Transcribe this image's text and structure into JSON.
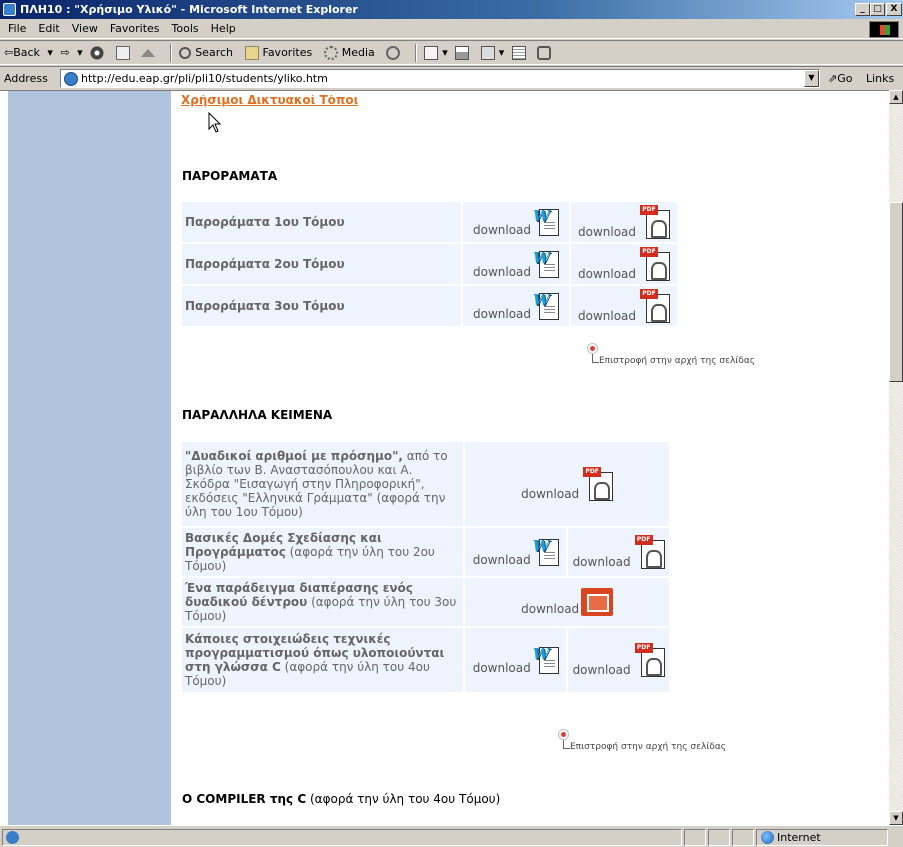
{
  "window": {
    "title": "ΠΛΗ10 : \"Χρήσιμο Υλικό\" - Microsoft Internet Explorer",
    "btn_min": "_",
    "btn_max": "□",
    "btn_close": "X"
  },
  "menubar": {
    "items": [
      "File",
      "Edit",
      "View",
      "Favorites",
      "Tools",
      "Help"
    ]
  },
  "toolbar": {
    "back": "⇦Back",
    "forward": "⇨",
    "search": "Search",
    "favorites": "Favorites",
    "media": "Media"
  },
  "address": {
    "label": "Address",
    "url": "http://edu.eap.gr/pli/pli10/students/yliko.htm",
    "go": "Go",
    "links": "Links »"
  },
  "status": {
    "zone": "Internet"
  },
  "page": {
    "top_link": "Χρήσιμοι Δικτυακοί Τόποι",
    "section1": {
      "title": "ΠΑΡΟΡΑΜΑΤΑ",
      "rows": [
        {
          "label": "Παροράματα 1ου Τόμου",
          "dl_word": "download",
          "dl_pdf": "download"
        },
        {
          "label": "Παροράματα 2ου Τόμου",
          "dl_word": "download",
          "dl_pdf": "download"
        },
        {
          "label": "Παροράματα 3ου Τόμου",
          "dl_word": "download",
          "dl_pdf": "download"
        }
      ],
      "back_to_top": "Επιστροφή στην αρχή της σελίδας"
    },
    "section2": {
      "title": "ΠΑΡΑΛΛΗΛΑ ΚΕΙΜΕΝΑ",
      "rows": [
        {
          "bold": "\"Δυαδικοί αριθμοί με πρόσημο\",",
          "desc": " από το βιβλίο των Β. Αναστασόπουλου και Α. Σκόδρα \"Εισαγωγή στην Πληροφορική\", εκδόσεις \"Ελληνικά Γράμματα\" (αφορά την ύλη του 1ου Τόμου)",
          "dl": "download"
        },
        {
          "bold": "Βασικές Δομές Σχεδίασης και Προγράμματος",
          "desc": " (αφορά την ύλη του 2ου Τόμου)",
          "dl_word": "download",
          "dl_pdf": "download"
        },
        {
          "bold": "Ένα παράδειγμα διαπέρασης ενός δυαδικού δέντρου",
          "desc": " (αφορά την ύλη του 3ου Τόμου)",
          "dl": "download"
        },
        {
          "bold": "Κάποιες στοιχειώδεις τεχνικές προγραμματισμού όπως υλοποιούνται στη γλώσσα C",
          "desc": " (αφορά την ύλη του 4ου Τόμου)",
          "dl_word": "download",
          "dl_pdf": "download"
        }
      ],
      "back_to_top": "Επιστροφή στην αρχή της σελίδας"
    },
    "section3": {
      "bold": "Ο COMPILER της C",
      "desc": " (αφορά την ύλη του 4ου Τόμου)"
    }
  }
}
